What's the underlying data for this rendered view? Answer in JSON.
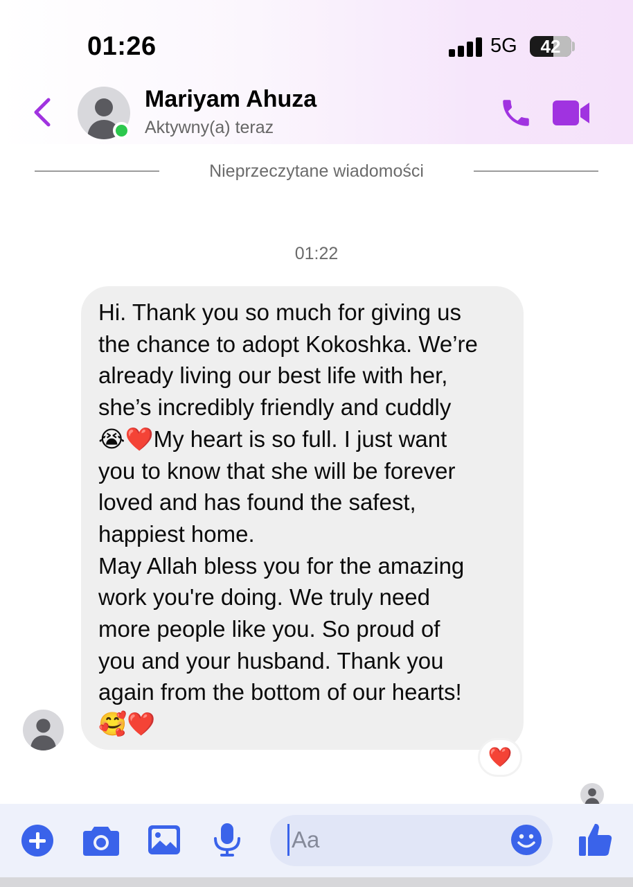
{
  "status_bar": {
    "time": "01:26",
    "network": "5G",
    "battery": "42"
  },
  "header": {
    "name": "Mariyam Ahuza",
    "status": "Aktywny(a) teraz"
  },
  "divider": {
    "label": "Nieprzeczytane wiadomości"
  },
  "thread": {
    "timestamp": "01:22",
    "message": "Hi. Thank you so much for giving us\nthe chance to adopt Kokoshka. We’re\nalready living our best life with her,\nshe’s incredibly friendly and cuddly\n😭❤️My heart is so full. I just want\nyou to know that she will be forever\nloved and has found the safest,\nhappiest home.\nMay Allah bless you for the amazing\nwork you're doing. We truly need\nmore people like you. So proud of\nyou and your husband. Thank you\nagain from the bottom of our hearts!\n🥰❤️",
    "reaction": "❤️"
  },
  "composer": {
    "placeholder": "Aa"
  },
  "icons": {
    "back": "chevron-left-icon",
    "call": "phone-icon",
    "video": "video-camera-icon",
    "plus": "plus-icon",
    "camera": "camera-icon",
    "gallery": "image-icon",
    "mic": "microphone-icon",
    "emoji": "smiley-icon",
    "like": "thumbs-up-icon"
  },
  "colors": {
    "accent_purple": "#a033e0",
    "accent_blue": "#3a63ea",
    "bubble_bg": "#efefef",
    "online_green": "#2cc84d"
  }
}
